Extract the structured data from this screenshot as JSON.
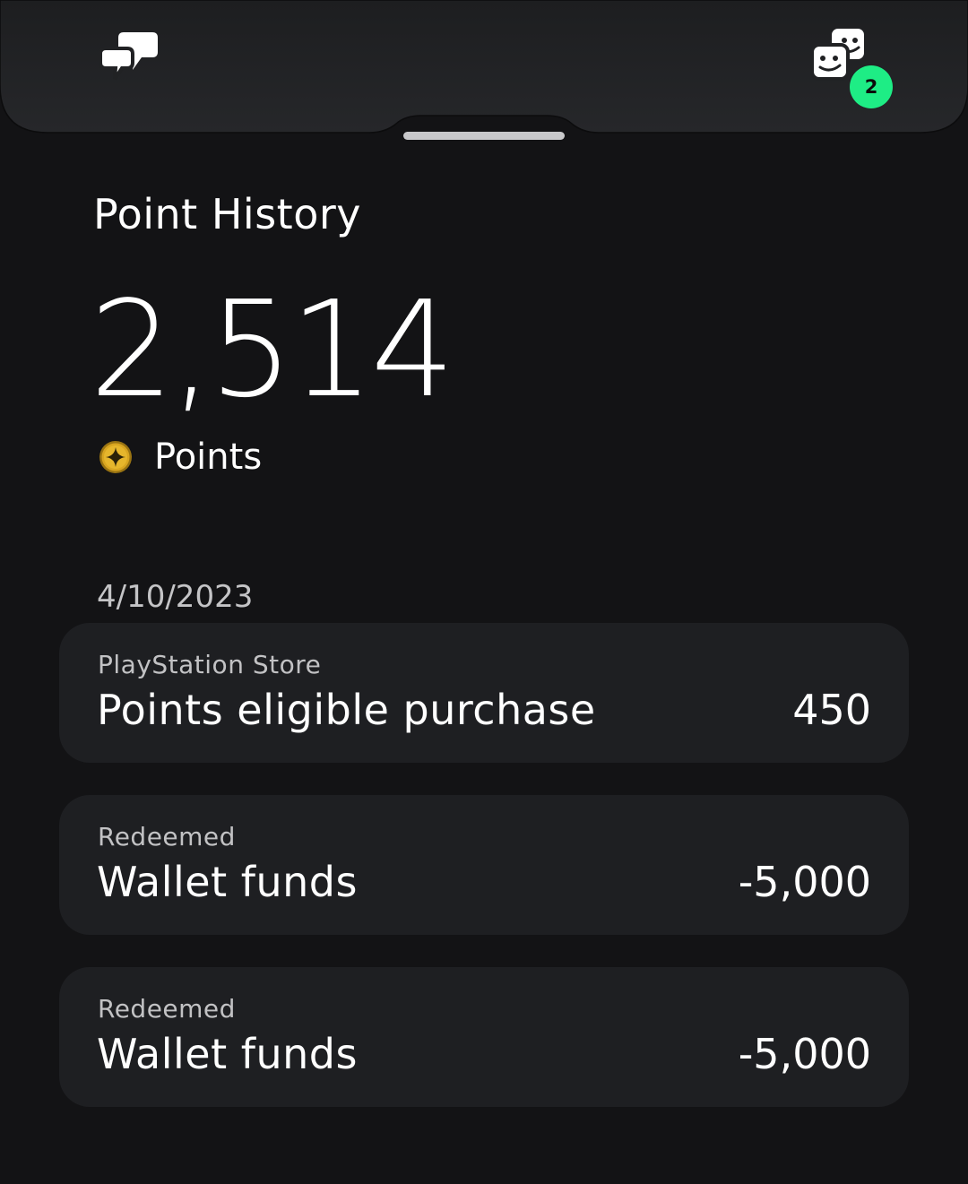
{
  "header": {
    "notification_count": "2",
    "icons": {
      "left": "chat-bubbles-icon",
      "right": "party-icon"
    }
  },
  "page": {
    "title": "Point History",
    "total_points": "2,514",
    "points_label": "Points",
    "coin_icon": "star-coin-icon"
  },
  "history": {
    "date": "4/10/2023",
    "transactions": [
      {
        "source": "PlayStation Store",
        "description": "Points eligible purchase",
        "amount": "450"
      },
      {
        "source": "Redeemed",
        "description": "Wallet funds",
        "amount": "-5,000"
      },
      {
        "source": "Redeemed",
        "description": "Wallet funds",
        "amount": "-5,000"
      }
    ]
  },
  "colors": {
    "background": "#131315",
    "header_sheet": "#222325",
    "card": "#1e1f22",
    "badge": "#1eed85",
    "coin": "#d8a520"
  }
}
